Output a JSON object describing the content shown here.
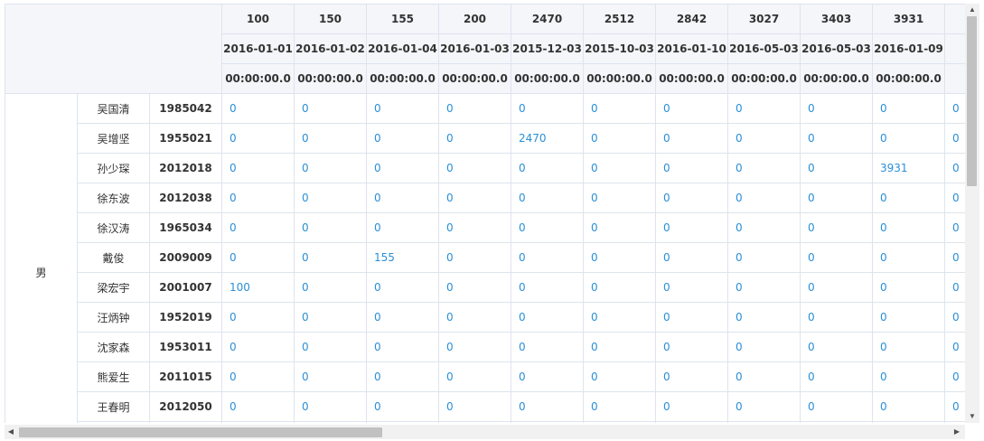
{
  "columns": [
    {
      "amount": "100",
      "date": "2016-01-01",
      "time": "00:00:00.0"
    },
    {
      "amount": "150",
      "date": "2016-01-02",
      "time": "00:00:00.0"
    },
    {
      "amount": "155",
      "date": "2016-01-04",
      "time": "00:00:00.0"
    },
    {
      "amount": "200",
      "date": "2016-01-03",
      "time": "00:00:00.0"
    },
    {
      "amount": "2470",
      "date": "2015-12-03",
      "time": "00:00:00.0"
    },
    {
      "amount": "2512",
      "date": "2015-10-03",
      "time": "00:00:00.0"
    },
    {
      "amount": "2842",
      "date": "2016-01-10",
      "time": "00:00:00.0"
    },
    {
      "amount": "3027",
      "date": "2016-05-03",
      "time": "00:00:00.0"
    },
    {
      "amount": "3403",
      "date": "2016-05-03",
      "time": "00:00:00.0"
    },
    {
      "amount": "3931",
      "date": "2016-01-09",
      "time": "00:00:00.0"
    },
    {
      "amount": "",
      "date": "20",
      "time": "00"
    }
  ],
  "group_label": "男",
  "rows": [
    {
      "name": "吴国清",
      "id": "1985042",
      "values": [
        "0",
        "0",
        "0",
        "0",
        "0",
        "0",
        "0",
        "0",
        "0",
        "0",
        "0"
      ]
    },
    {
      "name": "吴增坚",
      "id": "1955021",
      "values": [
        "0",
        "0",
        "0",
        "0",
        "2470",
        "0",
        "0",
        "0",
        "0",
        "0",
        "0"
      ]
    },
    {
      "name": "孙少琛",
      "id": "2012018",
      "values": [
        "0",
        "0",
        "0",
        "0",
        "0",
        "0",
        "0",
        "0",
        "0",
        "3931",
        "0"
      ]
    },
    {
      "name": "徐东波",
      "id": "2012038",
      "values": [
        "0",
        "0",
        "0",
        "0",
        "0",
        "0",
        "0",
        "0",
        "0",
        "0",
        "0"
      ]
    },
    {
      "name": "徐汉涛",
      "id": "1965034",
      "values": [
        "0",
        "0",
        "0",
        "0",
        "0",
        "0",
        "0",
        "0",
        "0",
        "0",
        "0"
      ]
    },
    {
      "name": "戴俊",
      "id": "2009009",
      "values": [
        "0",
        "0",
        "155",
        "0",
        "0",
        "0",
        "0",
        "0",
        "0",
        "0",
        "0"
      ]
    },
    {
      "name": "梁宏宇",
      "id": "2001007",
      "values": [
        "100",
        "0",
        "0",
        "0",
        "0",
        "0",
        "0",
        "0",
        "0",
        "0",
        "0"
      ]
    },
    {
      "name": "汪炳钟",
      "id": "1952019",
      "values": [
        "0",
        "0",
        "0",
        "0",
        "0",
        "0",
        "0",
        "0",
        "0",
        "0",
        "0"
      ]
    },
    {
      "name": "沈家森",
      "id": "1953011",
      "values": [
        "0",
        "0",
        "0",
        "0",
        "0",
        "0",
        "0",
        "0",
        "0",
        "0",
        "0"
      ]
    },
    {
      "name": "熊爱生",
      "id": "2011015",
      "values": [
        "0",
        "0",
        "0",
        "0",
        "0",
        "0",
        "0",
        "0",
        "0",
        "0",
        "0"
      ]
    },
    {
      "name": "王春明",
      "id": "2012050",
      "values": [
        "0",
        "0",
        "0",
        "0",
        "0",
        "0",
        "0",
        "0",
        "0",
        "0",
        "0"
      ]
    },
    {
      "name": "",
      "id": "",
      "values": [
        "",
        "",
        "",
        "",
        "",
        "",
        "",
        "",
        "",
        "",
        ""
      ]
    }
  ],
  "scrollbar": {
    "up": "▲",
    "down": "▼",
    "left": "◀",
    "right": "▶"
  }
}
